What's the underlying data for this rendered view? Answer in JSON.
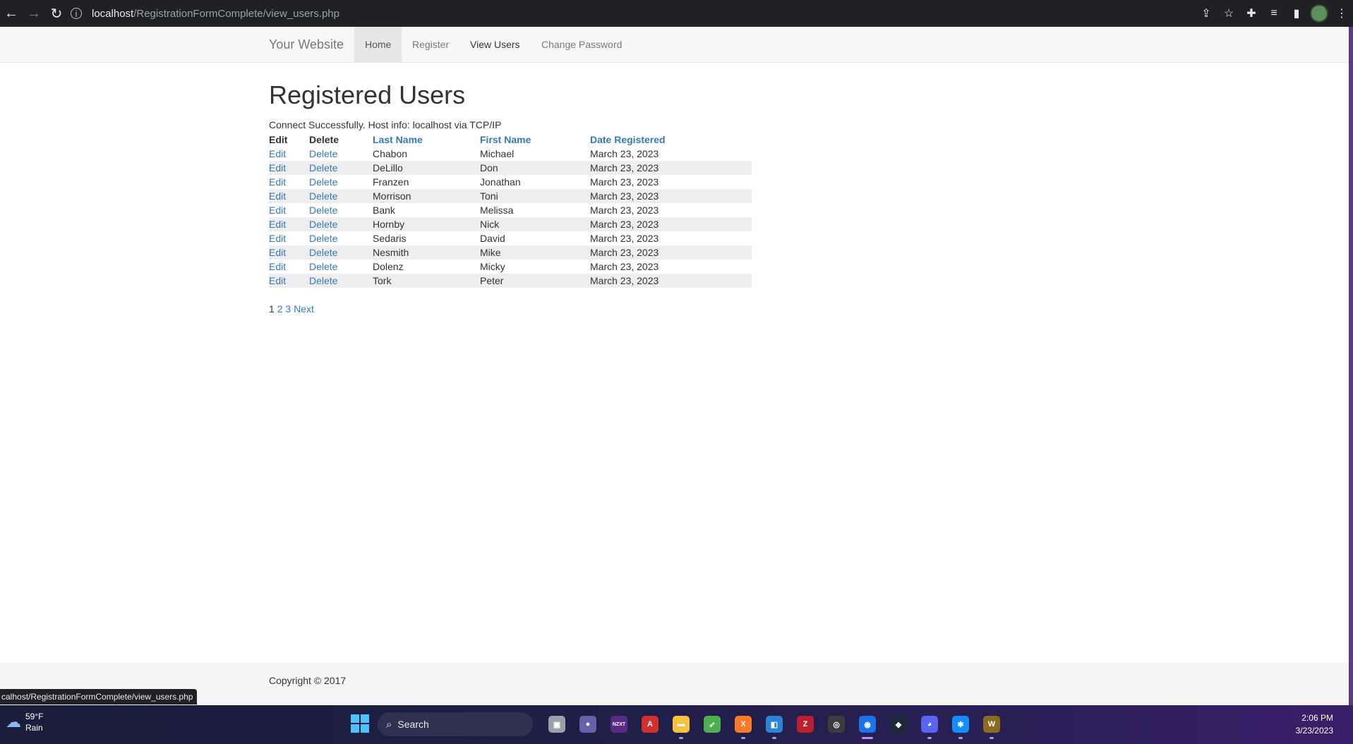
{
  "browser": {
    "url_host": "localhost",
    "url_path": "/RegistrationFormComplete/view_users.php",
    "status_url": "calhost/RegistrationFormComplete/view_users.php"
  },
  "navbar": {
    "brand": "Your Website",
    "items": [
      {
        "label": "Home"
      },
      {
        "label": "Register"
      },
      {
        "label": "View Users"
      },
      {
        "label": "Change Password"
      }
    ]
  },
  "page": {
    "title": "Registered Users",
    "connection": "Connect Successfully. Host info: localhost via TCP/IP"
  },
  "table": {
    "headers": [
      "Edit",
      "Delete",
      "Last Name",
      "First Name",
      "Date Registered"
    ],
    "rows": [
      {
        "edit": "Edit",
        "delete": "Delete",
        "last": "Chabon",
        "first": "Michael",
        "date": "March 23, 2023"
      },
      {
        "edit": "Edit",
        "delete": "Delete",
        "last": "DeLillo",
        "first": "Don",
        "date": "March 23, 2023"
      },
      {
        "edit": "Edit",
        "delete": "Delete",
        "last": "Franzen",
        "first": "Jonathan",
        "date": "March 23, 2023"
      },
      {
        "edit": "Edit",
        "delete": "Delete",
        "last": "Morrison",
        "first": "Toni",
        "date": "March 23, 2023"
      },
      {
        "edit": "Edit",
        "delete": "Delete",
        "last": "Bank",
        "first": "Melissa",
        "date": "March 23, 2023"
      },
      {
        "edit": "Edit",
        "delete": "Delete",
        "last": "Hornby",
        "first": "Nick",
        "date": "March 23, 2023"
      },
      {
        "edit": "Edit",
        "delete": "Delete",
        "last": "Sedaris",
        "first": "David",
        "date": "March 23, 2023"
      },
      {
        "edit": "Edit",
        "delete": "Delete",
        "last": "Nesmith",
        "first": "Mike",
        "date": "March 23, 2023"
      },
      {
        "edit": "Edit",
        "delete": "Delete",
        "last": "Dolenz",
        "first": "Micky",
        "date": "March 23, 2023"
      },
      {
        "edit": "Edit",
        "delete": "Delete",
        "last": "Tork",
        "first": "Peter",
        "date": "March 23, 2023"
      }
    ]
  },
  "pagination": {
    "current": "1",
    "pages": [
      "2",
      "3"
    ],
    "next": "Next"
  },
  "footer": {
    "copyright": "Copyright © 2017"
  },
  "taskbar": {
    "temperature": "59°F",
    "condition": "Rain",
    "search_label": "Search",
    "time": "2:06 PM",
    "date": "3/23/2023",
    "apps": [
      {
        "name": "task-view-icon",
        "glyph": "▣",
        "color": "#9aa0a6"
      },
      {
        "name": "teams-icon",
        "glyph": "●",
        "color": "#6264a7"
      },
      {
        "name": "nzxt-icon",
        "glyph": "NZXT",
        "color": "#5b2a86"
      },
      {
        "name": "acrobat-icon",
        "glyph": "A",
        "color": "#d32f2f"
      },
      {
        "name": "file-explorer-icon",
        "glyph": "▬",
        "color": "#f9c23c"
      },
      {
        "name": "hummingbird-icon",
        "glyph": "➶",
        "color": "#4caf50"
      },
      {
        "name": "xampp-icon",
        "glyph": "X",
        "color": "#fb7a24"
      },
      {
        "name": "code-editor-icon",
        "glyph": "◧",
        "color": "#2b84d8"
      },
      {
        "name": "filezilla-icon",
        "glyph": "Z",
        "color": "#bf1e2e"
      },
      {
        "name": "obs-icon",
        "glyph": "◎",
        "color": "#3c3c3c"
      },
      {
        "name": "chrome-icon",
        "glyph": "◉",
        "color": "#1a73e8"
      },
      {
        "name": "steam-icon",
        "glyph": "◆",
        "color": "#1b2838"
      },
      {
        "name": "discord-icon",
        "glyph": "◕",
        "color": "#5865f2"
      },
      {
        "name": "battlenet-icon",
        "glyph": "✱",
        "color": "#148eff"
      },
      {
        "name": "wow-icon",
        "glyph": "W",
        "color": "#8c6a1f"
      }
    ]
  }
}
